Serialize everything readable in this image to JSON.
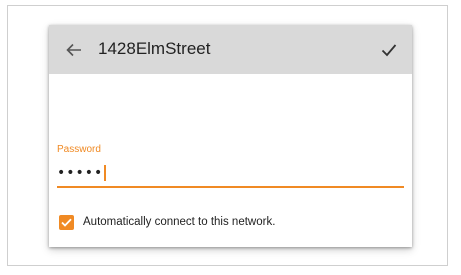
{
  "dialog": {
    "title": "1428ElmStreet",
    "back_icon": "arrow-left-icon",
    "confirm_icon": "checkmark-icon"
  },
  "password": {
    "label": "Password",
    "value": "•••••"
  },
  "auto_connect": {
    "label": "Automatically connect to this network.",
    "checked": true
  },
  "colors": {
    "accent": "#f08a24",
    "toolbar": "#d9d9d9"
  }
}
